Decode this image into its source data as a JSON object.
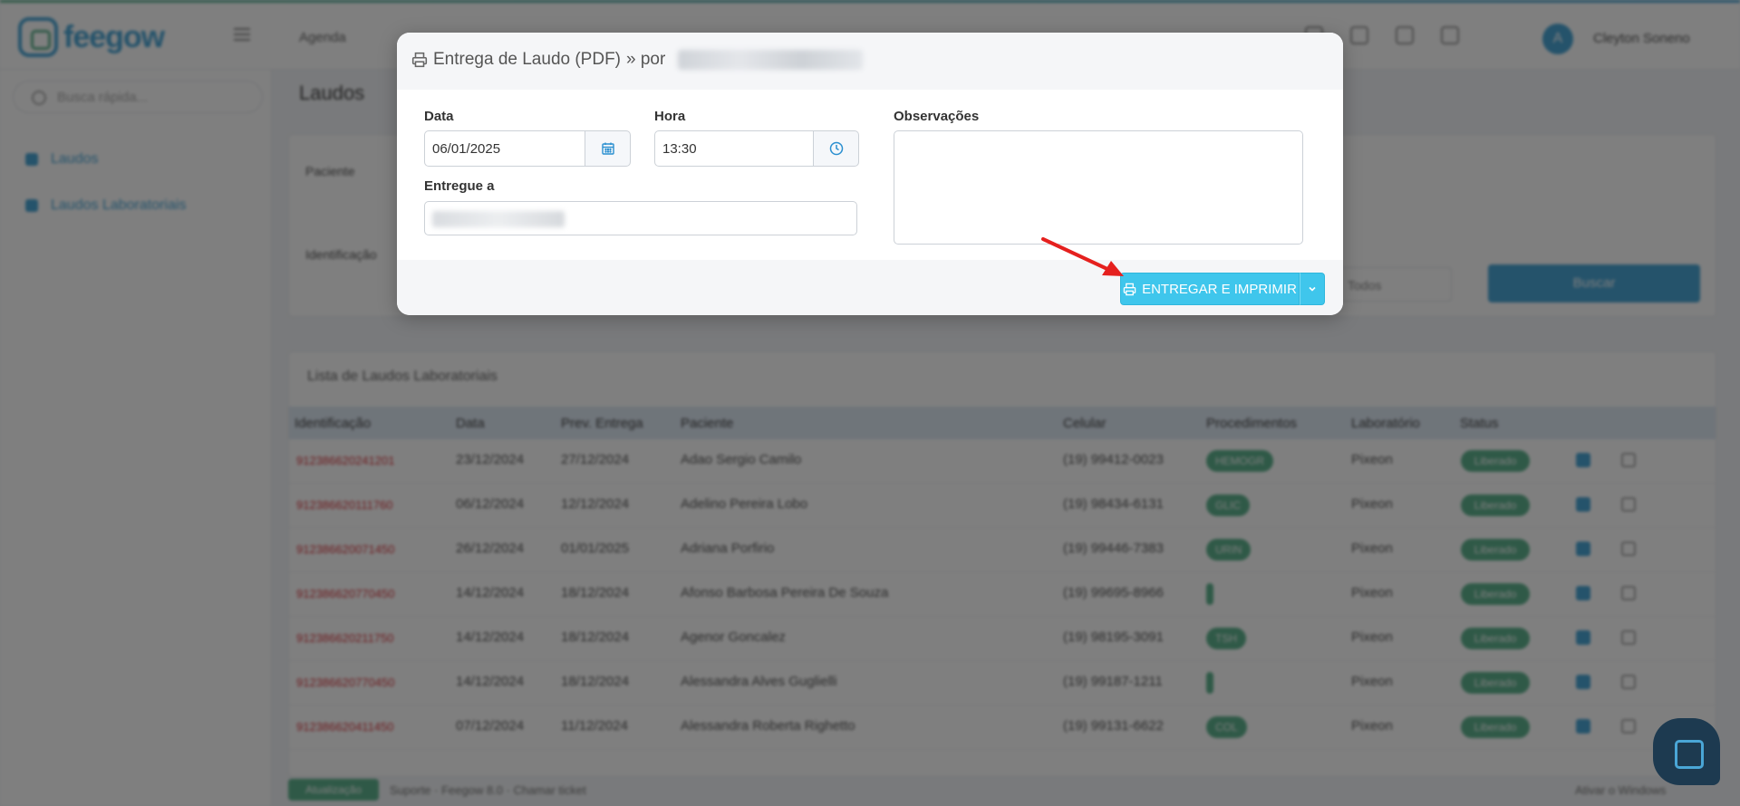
{
  "app": {
    "logo_text": "feegow",
    "topnav_label": "Agenda",
    "user_initial": "A",
    "user_name": "Cleyton Soneno",
    "search_placeholder": "Busca rápida...",
    "page_title": "Laudos",
    "sidebar": {
      "items": [
        {
          "label": "Laudos"
        },
        {
          "label": "Laudos Laboratoriais"
        }
      ]
    },
    "filters": {
      "paciente_label": "Paciente",
      "identificacao_label": "Identificação",
      "select_value": "Todos",
      "search_button": "Buscar"
    },
    "list": {
      "title": "Lista de Laudos Laboratoriais",
      "headers": [
        "Identificação",
        "Data",
        "Prev. Entrega",
        "Paciente",
        "Celular",
        "Procedimentos",
        "Laboratório",
        "Status"
      ],
      "rows": [
        {
          "id": "912386620241201",
          "date": "23/12/2024",
          "prev": "27/12/2024",
          "patient": "Adao Sergio Camilo",
          "phone": "(19) 99412-0023",
          "proc": "HEMOGR",
          "lab": "Pixeon",
          "status": "Liberado"
        },
        {
          "id": "912386620111760",
          "date": "06/12/2024",
          "prev": "12/12/2024",
          "patient": "Adelino Pereira Lobo",
          "phone": "(19) 98434-6131",
          "proc": "GLIC",
          "lab": "Pixeon",
          "status": "Liberado"
        },
        {
          "id": "912386620071450",
          "date": "26/12/2024",
          "prev": "01/01/2025",
          "patient": "Adriana Porfirio",
          "phone": "(19) 99446-7383",
          "proc": "URIN",
          "lab": "Pixeon",
          "status": "Liberado"
        },
        {
          "id": "912386620770450",
          "date": "14/12/2024",
          "prev": "18/12/2024",
          "patient": "Afonso Barbosa Pereira De Souza",
          "phone": "(19) 99695-8966",
          "proc": "",
          "lab": "Pixeon",
          "status": "Liberado"
        },
        {
          "id": "912386620211750",
          "date": "14/12/2024",
          "prev": "18/12/2024",
          "patient": "Agenor Goncalez",
          "phone": "(19) 98195-3091",
          "proc": "TSH",
          "lab": "Pixeon",
          "status": "Liberado"
        },
        {
          "id": "912386620770450",
          "date": "14/12/2024",
          "prev": "18/12/2024",
          "patient": "Alessandra Alves Guglielli",
          "phone": "(19) 99187-1211",
          "proc": "",
          "lab": "Pixeon",
          "status": "Liberado"
        },
        {
          "id": "912386620411450",
          "date": "07/12/2024",
          "prev": "11/12/2024",
          "patient": "Alessandra Roberta Righetto",
          "phone": "(19) 99131-6622",
          "proc": "COL",
          "lab": "Pixeon",
          "status": "Liberado"
        }
      ]
    },
    "footer": {
      "pill": "Atualização",
      "support": "Suporte · Feegow 8.0 · Chamar ticket",
      "watermark": "Ativar o Windows"
    }
  },
  "modal": {
    "title_main": "Entrega de Laudo (PDF)",
    "title_sep": "» por",
    "data_label": "Data",
    "data_value": "06/01/2025",
    "hora_label": "Hora",
    "hora_value": "13:30",
    "observacoes_label": "Observações",
    "observacoes_value": "",
    "entregue_label": "Entregue a",
    "submit_label": "ENTREGAR E IMPRIMIR"
  },
  "colors": {
    "accent": "#4aa6d6",
    "button": "#3fc6ec",
    "success": "#5fb38f",
    "danger": "#d9363e",
    "annotation_arrow": "#e5201e"
  },
  "icons": [
    "printer-icon",
    "calendar-icon",
    "clock-icon",
    "chevron-down-icon",
    "search-icon",
    "arrow-annotation-icon"
  ]
}
